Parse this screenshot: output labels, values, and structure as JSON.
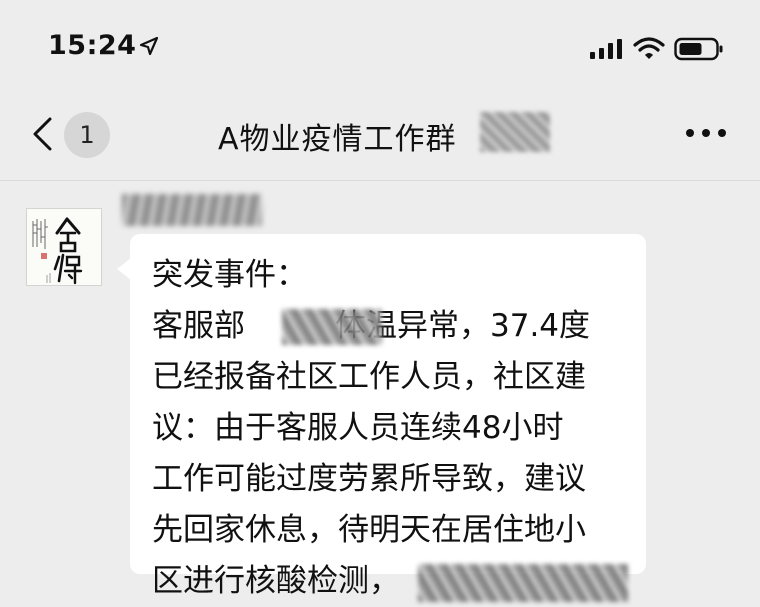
{
  "status_bar": {
    "time": "15:24",
    "icons": [
      "location-arrow-icon",
      "cellular-signal-icon",
      "wifi-icon",
      "battery-icon"
    ]
  },
  "nav_bar": {
    "back_icon": "chevron-left-icon",
    "unread_count": "1",
    "title": "A物业疫情工作群",
    "more_icon": "more-dots-icon"
  },
  "message": {
    "avatar_text": "舍得",
    "lines": [
      {
        "a": "突发事件：",
        "b": ""
      },
      {
        "a": "客服部",
        "b": "体温异常，37.4度"
      },
      {
        "a": "已经报备社区工作人员，社区建",
        "b": ""
      },
      {
        "a": "议：由于客服人员连续48小时",
        "b": ""
      },
      {
        "a": "工作可能过度劳累所导致，建议",
        "b": ""
      },
      {
        "a": "先回家休息，待明天在居住地小",
        "b": ""
      },
      {
        "a": "区进行核酸检测，",
        "b": ""
      }
    ]
  },
  "colors": {
    "background": "#ededed",
    "bubble": "#ffffff",
    "text": "#111111",
    "badge": "#d6d6d6"
  }
}
